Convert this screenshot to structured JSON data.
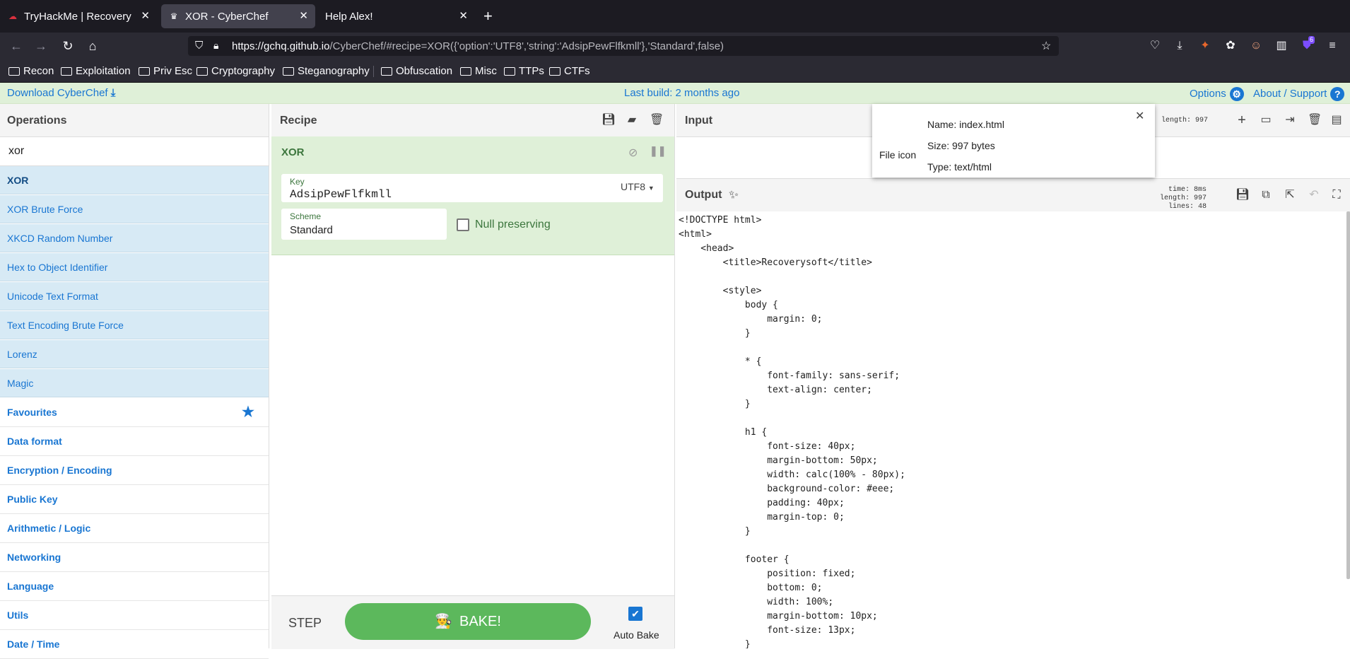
{
  "browser": {
    "tabs": [
      {
        "title": "TryHackMe | Recovery",
        "active": false
      },
      {
        "title": "XOR - CyberChef",
        "active": true
      },
      {
        "title": "Help Alex!",
        "active": false
      }
    ],
    "new_tab": "+",
    "url_host": "https://gchq.github.io",
    "url_rest": "/CyberChef/#recipe=XOR({'option':'UTF8','string':'AdsipPewFlfkmll'},'Standard',false)",
    "extension_badge": "6",
    "bookmarks": [
      "Recon",
      "Exploitation",
      "Priv Esc",
      "Cryptography",
      "Steganography",
      "Obfuscation",
      "Misc",
      "TTPs",
      "CTFs"
    ]
  },
  "banner": {
    "download": "Download CyberChef",
    "last_build": "Last build: 2 months ago",
    "options": "Options",
    "about": "About / Support"
  },
  "operations": {
    "title": "Operations",
    "search_value": "xor",
    "results": [
      "XOR",
      "XOR Brute Force",
      "XKCD Random Number",
      "Hex to Object Identifier",
      "Unicode Text Format",
      "Text Encoding Brute Force",
      "Lorenz",
      "Magic"
    ],
    "categories": [
      "Favourites",
      "Data format",
      "Encryption / Encoding",
      "Public Key",
      "Arithmetic / Logic",
      "Networking",
      "Language",
      "Utils",
      "Date / Time"
    ]
  },
  "recipe": {
    "title": "Recipe",
    "operation": "XOR",
    "key_label": "Key",
    "key_value": "AdsipPewFlfkmll",
    "key_encoding": "UTF8",
    "scheme_label": "Scheme",
    "scheme_value": "Standard",
    "null_preserving": "Null preserving",
    "step": "STEP",
    "bake": "BAKE!",
    "auto_bake": "Auto Bake"
  },
  "input": {
    "title": "Input",
    "length_label": "length:",
    "length_value": "997"
  },
  "file_popup": {
    "icon_label": "File icon",
    "name": "Name: index.html",
    "size": "Size: 997 bytes",
    "type": "Type: text/html"
  },
  "output": {
    "title": "Output",
    "time_label": "time:",
    "time_value": "8ms",
    "length_label": "length:",
    "length_value": "997",
    "lines_label": "lines:",
    "lines_value": "48",
    "text": "<!DOCTYPE html>\n<html>\n    <head>\n        <title>Recoverysoft</title>\n\n        <style>\n            body {\n                margin: 0;\n            }\n\n            * {\n                font-family: sans-serif;\n                text-align: center;\n            }\n\n            h1 {\n                font-size: 40px;\n                margin-bottom: 50px;\n                width: calc(100% - 80px);\n                background-color: #eee;\n                padding: 40px;\n                margin-top: 0;\n            }\n\n            footer {\n                position: fixed;\n                bottom: 0;\n                width: 100%;\n                margin-bottom: 10px;\n                font-size: 13px;\n            }"
  }
}
